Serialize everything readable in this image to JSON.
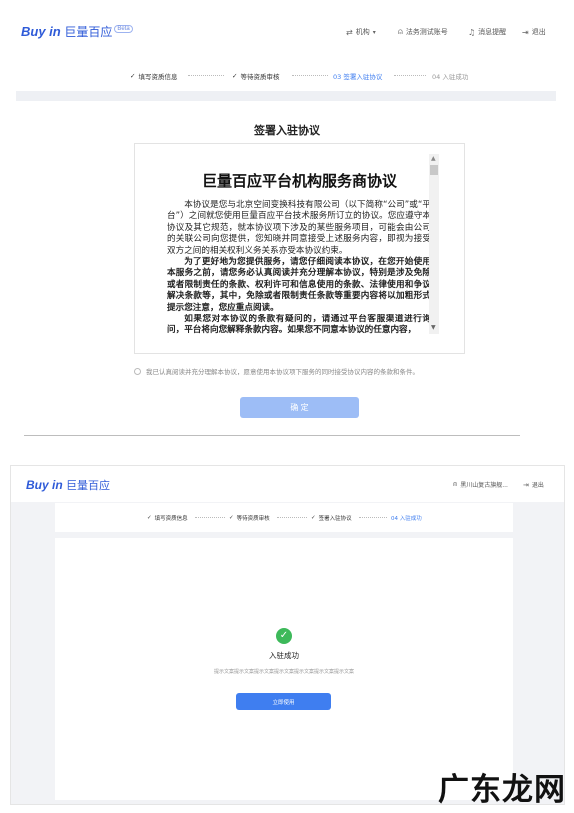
{
  "top": {
    "logo": {
      "brand": "Buy in",
      "cn": "巨量百应",
      "badge": "Beta"
    },
    "header": {
      "org_label": "机构",
      "account_label": "法务测试账号",
      "notify_label": "消息提醒",
      "logout_label": "退出"
    },
    "steps": [
      {
        "label": "填写资质信息",
        "state": "done"
      },
      {
        "label": "等待资质审核",
        "state": "done"
      },
      {
        "label": "03 签署入驻协议",
        "state": "active"
      },
      {
        "label": "04 入驻成功",
        "state": "todo"
      }
    ],
    "section_title": "签署入驻协议",
    "agreement": {
      "title": "巨量百应平台机构服务商协议",
      "p1": "本协议是您与北京空间变换科技有限公司（以下简称“公司”或“平台”）之间就您使用巨量百应平台技术服务所订立的协议。您应遵守本协议及其它规范，就本协议项下涉及的某些服务项目，可能会由公司的关联公司向您提供，您知晓并同意接受上述服务内容，即视为接受双方之间的相关权利义务关系亦受本协议约束。",
      "p2": "为了更好地为您提供服务，请您仔细阅读本协议，在您开始使用本服务之前，请您务必认真阅读并充分理解本协议，特别是涉及免除或者限制责任的条款、权利许可和信息使用的条款、法律使用和争议解决条款等，其中，免除或者限制责任条款等重要内容将以加粗形式提示您注意，您应重点阅读。",
      "p3": "如果您对本协议的条款有疑问的，请通过平台客服渠道进行询问，平台将向您解释条款内容。如果您不同意本协议的任意内容，"
    },
    "checkbox_label": "我已认真阅读并充分理解本协议，愿意使用本协议项下服务的同时接受协议内容的条款和条件。",
    "confirm_label": "确 定"
  },
  "bottom": {
    "logo": {
      "brand": "Buy in",
      "cn": "巨量百应"
    },
    "header": {
      "account_label": "黑川山复古旗舰...",
      "logout_label": "退出"
    },
    "steps": [
      {
        "label": "填写资质信息",
        "state": "done"
      },
      {
        "label": "等待资质审核",
        "state": "done"
      },
      {
        "label": "签署入驻协议",
        "state": "done"
      },
      {
        "label": "04 入驻成功",
        "state": "active"
      }
    ],
    "success_title": "入驻成功",
    "hint_text": "提示文案提示文案提示文案提示文案提示文案提示文案提示文案",
    "use_now_label": "立即使用"
  },
  "watermark": "广东龙网",
  "colors": {
    "brand": "#2f5bd8",
    "accent": "#3f7ef0",
    "button_disabled": "#9dbdf6",
    "button_primary": "#3f7ef0",
    "success": "#3db95a"
  }
}
